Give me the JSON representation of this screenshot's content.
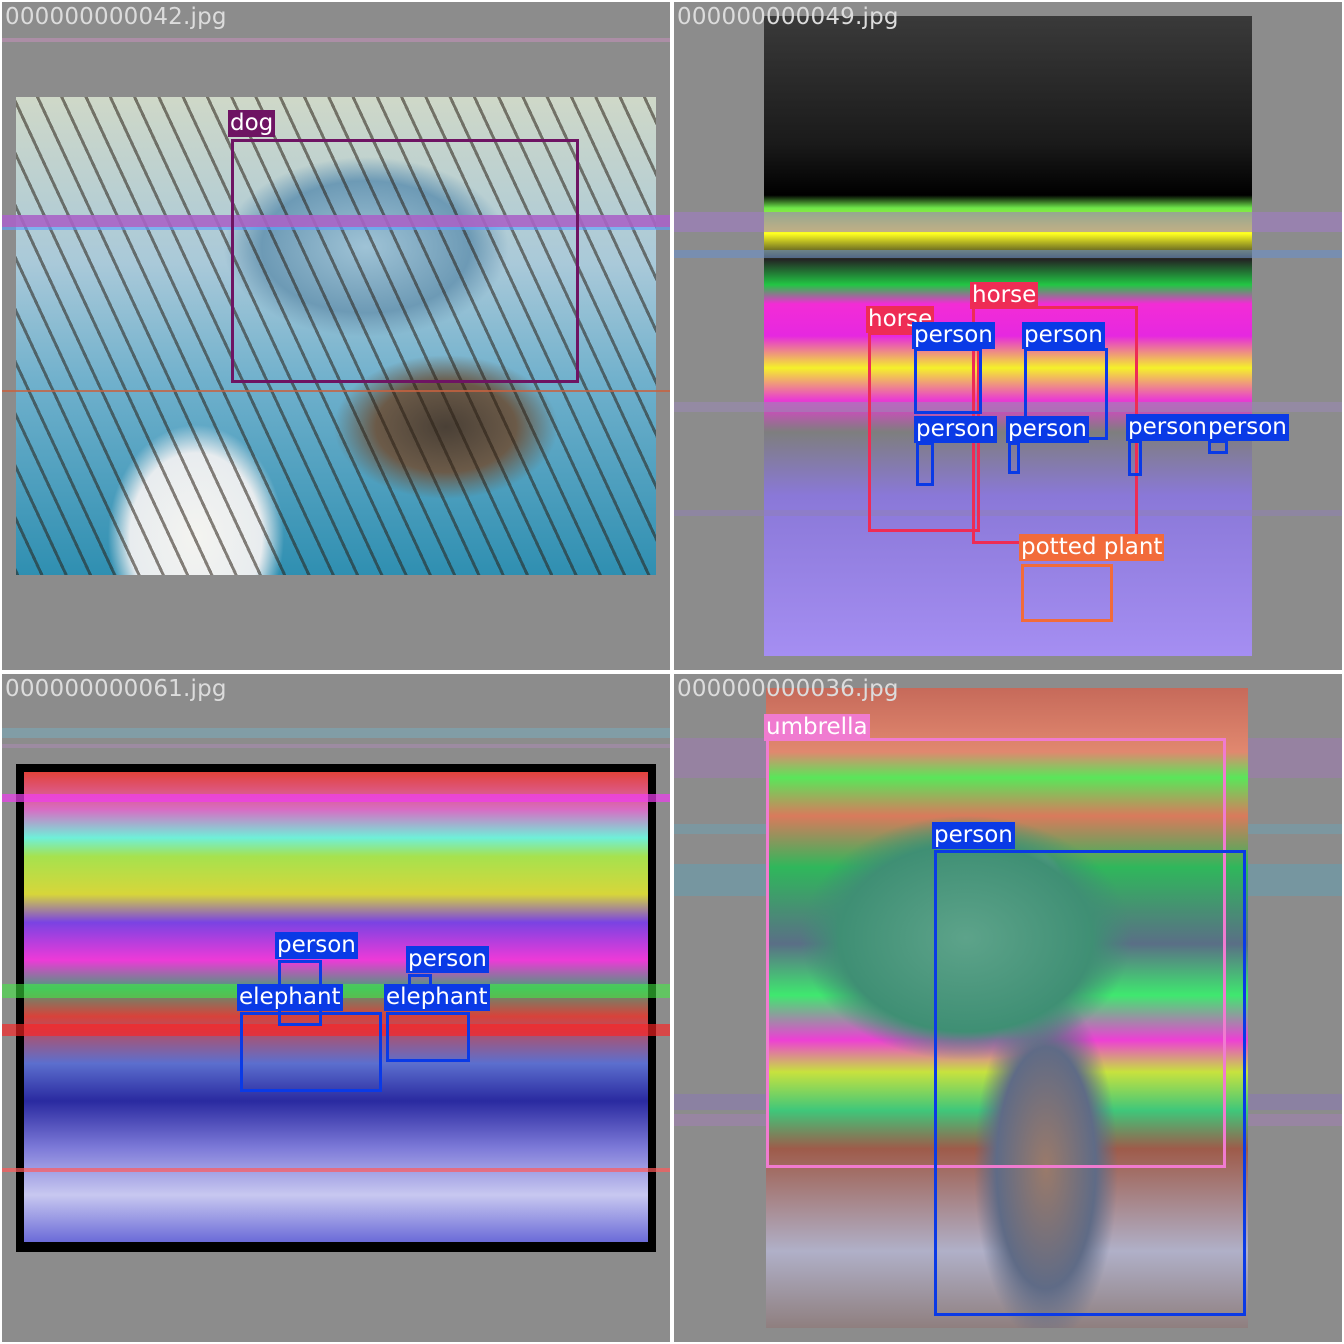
{
  "panels": [
    {
      "filename": "000000000042.jpg",
      "detections": [
        {
          "label": "dog",
          "color": "#6e1463"
        }
      ]
    },
    {
      "filename": "000000000049.jpg",
      "detections": [
        {
          "label": "horse",
          "color": "#ee2c55"
        },
        {
          "label": "horse",
          "color": "#ee2c55"
        },
        {
          "label": "person",
          "color": "#0a3ae6"
        },
        {
          "label": "person",
          "color": "#0a3ae6"
        },
        {
          "label": "person",
          "color": "#0a3ae6"
        },
        {
          "label": "person",
          "color": "#0a3ae6"
        },
        {
          "label": "person",
          "color": "#0a3ae6"
        },
        {
          "label": "person",
          "color": "#0a3ae6"
        },
        {
          "label": "potted plant",
          "color": "#f26b3a"
        }
      ]
    },
    {
      "filename": "000000000061.jpg",
      "detections": [
        {
          "label": "person",
          "color": "#0a3ae6"
        },
        {
          "label": "person",
          "color": "#0a3ae6"
        },
        {
          "label": "elephant",
          "color": "#0a3ae6"
        },
        {
          "label": "elephant",
          "color": "#0a3ae6"
        }
      ]
    },
    {
      "filename": "000000000036.jpg",
      "detections": [
        {
          "label": "umbrella",
          "color": "#f07bd0"
        },
        {
          "label": "person",
          "color": "#0a3ae6"
        }
      ]
    }
  ]
}
